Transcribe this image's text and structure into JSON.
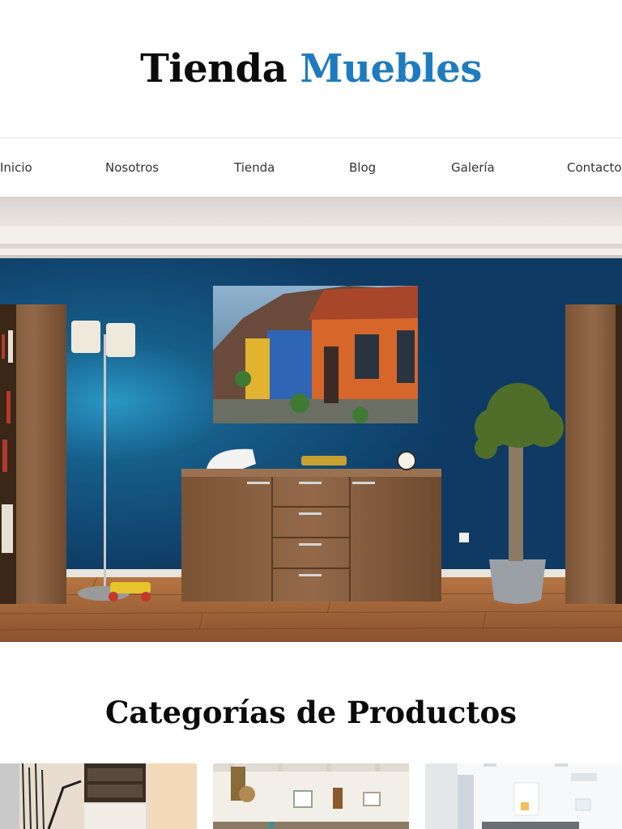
{
  "brand": {
    "word1": "Tienda",
    "word2": "Muebles",
    "accent": "#1e7bbf"
  },
  "nav": {
    "items": [
      {
        "label": "Inicio"
      },
      {
        "label": "Nosotros"
      },
      {
        "label": "Tienda"
      },
      {
        "label": "Blog"
      },
      {
        "label": "Galería"
      },
      {
        "label": "Contacto"
      }
    ]
  },
  "hero": {
    "image": "living-room-photo"
  },
  "categories": {
    "title": "Categorías de Productos",
    "items": [
      {
        "image": "office-room-photo"
      },
      {
        "image": "dining-room-photo"
      },
      {
        "image": "white-living-room-photo"
      }
    ]
  }
}
